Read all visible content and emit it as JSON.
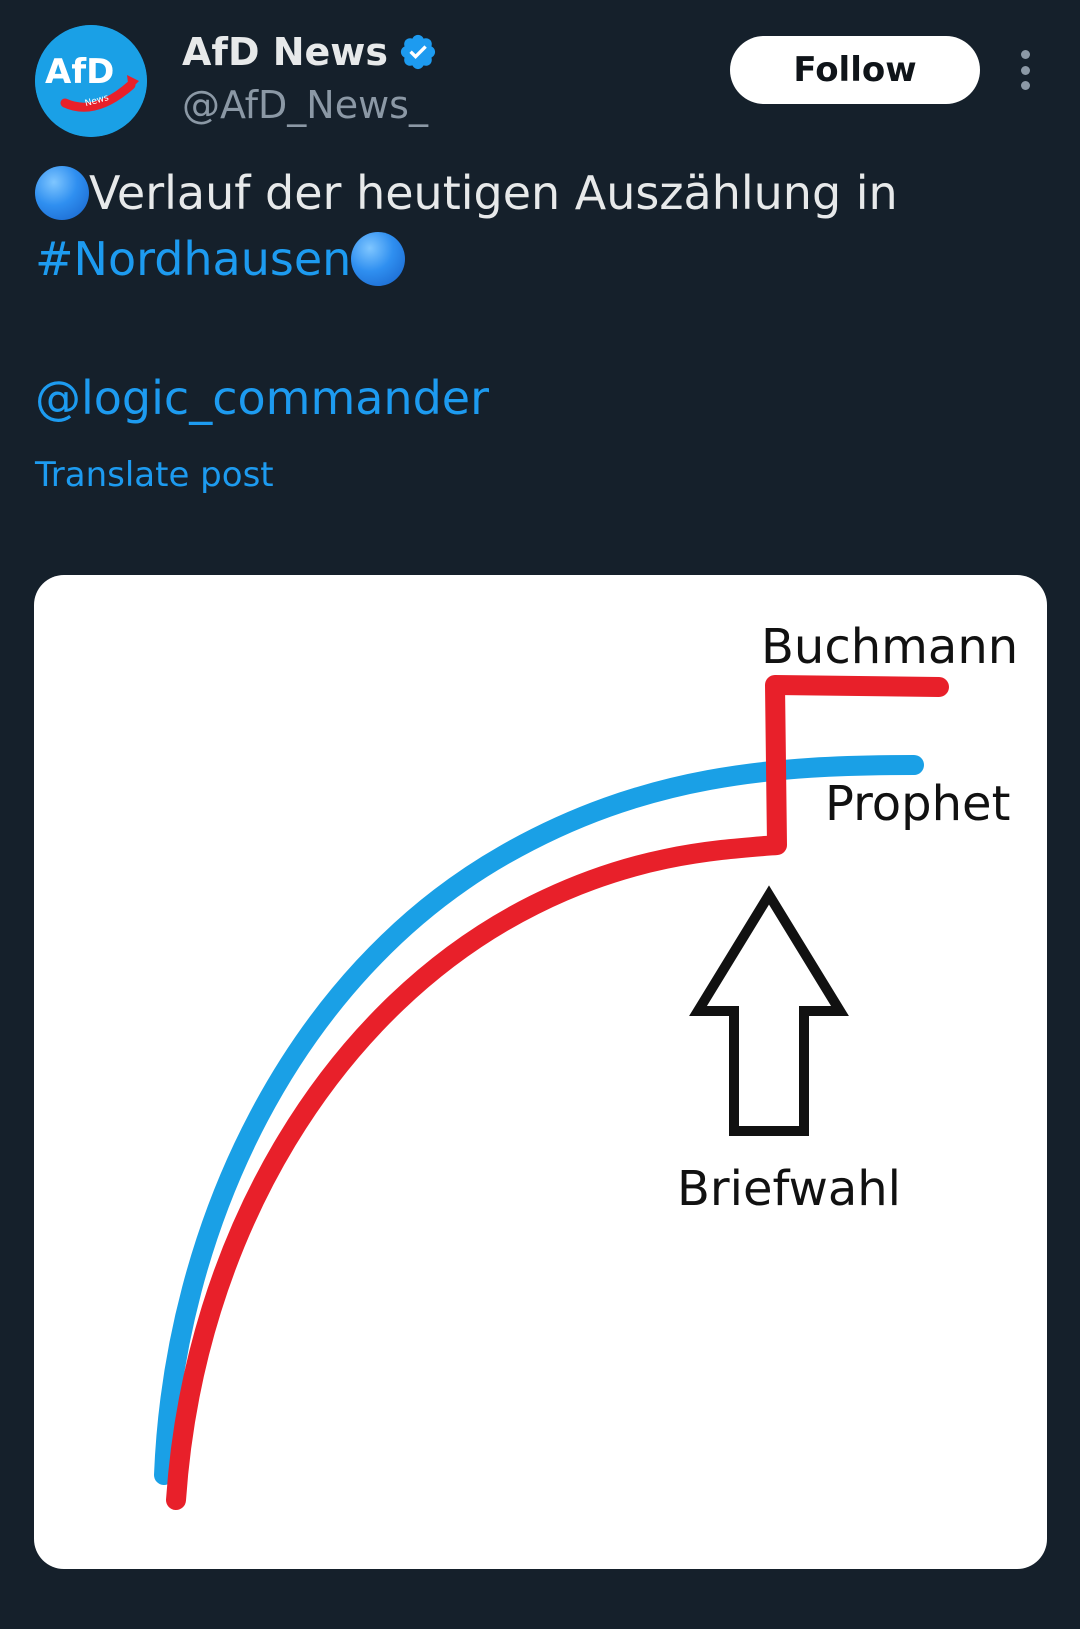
{
  "author": {
    "display_name": "AfD News",
    "handle": "@AfD_News_",
    "avatar_text": "AfD",
    "avatar_subtext": "News",
    "verified_icon": "verified-badge-icon"
  },
  "actions": {
    "follow_label": "Follow",
    "more_icon": "more-vertical-icon"
  },
  "post": {
    "line1_text": "Verlauf der heutigen Auszählung in",
    "hashtag": "#Nordhausen",
    "mention": "@logic_commander",
    "emoji_icon": "blue-circle-emoji"
  },
  "translate_label": "Translate post",
  "image": {
    "label_buchmann": "Buchmann",
    "label_prophet": "Prophet",
    "label_briefwahl": "Briefwahl",
    "colors": {
      "buchmann_line": "#e8202a",
      "prophet_line": "#1aa0e6",
      "arrow": "#111111"
    }
  },
  "colors": {
    "background": "#15202b",
    "accent": "#1d9bf0",
    "secondary_text": "#8b98a5"
  }
}
